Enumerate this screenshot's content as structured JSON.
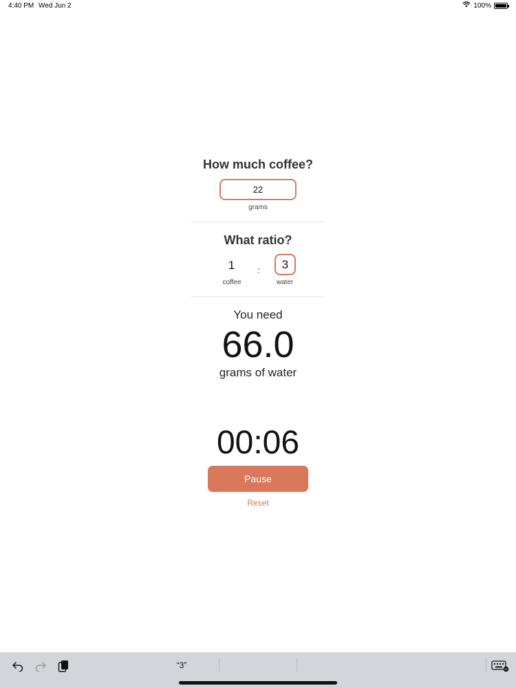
{
  "status_bar": {
    "time": "4:40 PM",
    "date": "Wed Jun 2",
    "battery_percent": "100%",
    "battery_level": 1.0,
    "wifi_icon": "wifi-icon"
  },
  "coffee_section": {
    "title": "How much coffee?",
    "amount_value": "22",
    "amount_unit": "grams"
  },
  "ratio_section": {
    "title": "What ratio?",
    "coffee_value": "1",
    "coffee_label": "coffee",
    "separator": ":",
    "water_value": "3",
    "water_label": "water"
  },
  "result": {
    "intro": "You need",
    "value": "66.0",
    "unit": "grams of water"
  },
  "timer": {
    "display": "00:06",
    "pause_label": "Pause",
    "reset_label": "Reset"
  },
  "keyboard_bar": {
    "undo_icon": "undo-icon",
    "redo_icon": "redo-icon",
    "paste_icon": "paste-icon",
    "suggestion": "“3”",
    "keyboard_icon": "keyboard-icon"
  },
  "colors": {
    "accent": "#d9785a",
    "keyboard_bar": "#d3d5db"
  }
}
